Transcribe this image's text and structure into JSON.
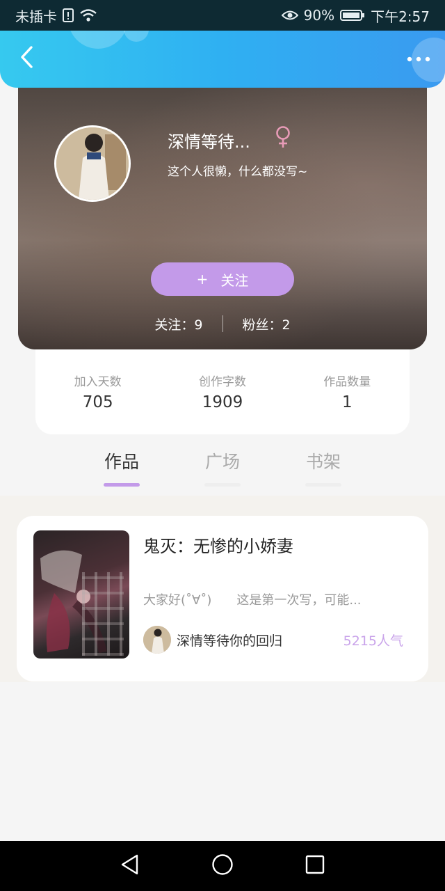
{
  "status_bar": {
    "carrier": "未插卡",
    "battery": "90%",
    "time": "下午2:57"
  },
  "header": {
    "back_icon": "chevron-left-icon",
    "more_icon": "more-dots-icon",
    "gradient": [
      "#36c9ef",
      "#3a9af0"
    ]
  },
  "profile": {
    "nickname": "深情等待...",
    "gender_icon": "female-icon",
    "bio": "这个人很懒，什么都没写~",
    "follow_button": {
      "icon": "+",
      "label": "关注"
    },
    "following": "关注：9",
    "fans": "粉丝：2"
  },
  "stats": [
    {
      "label": "加入天数",
      "value": "705"
    },
    {
      "label": "创作字数",
      "value": "1909"
    },
    {
      "label": "作品数量",
      "value": "1"
    }
  ],
  "tabs": [
    {
      "label": "作品",
      "active": true
    },
    {
      "label": "广场",
      "active": false
    },
    {
      "label": "书架",
      "active": false
    }
  ],
  "works": [
    {
      "title": "鬼灭：无惨的小娇妻",
      "description": "大家好(˚∀˚)　　这是第一次写，可能...",
      "author": "深情等待你的回归",
      "popularity": "5215人气"
    }
  ],
  "colors": {
    "accent": "#c39ae9",
    "popularity": "#c9a3ea"
  }
}
